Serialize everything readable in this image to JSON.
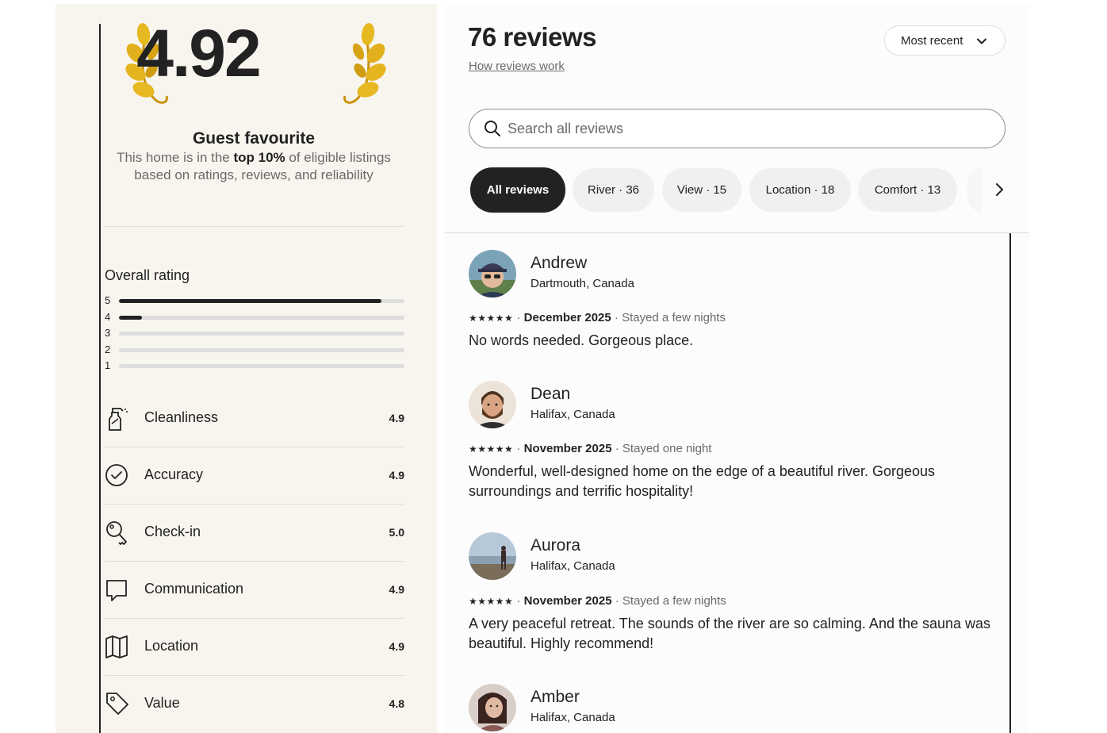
{
  "summary": {
    "score": "4.92",
    "badge_title": "Guest favourite",
    "desc_prefix": "This home is in the ",
    "desc_bold": "top 10%",
    "desc_suffix": " of eligible listings based on ratings, reviews, and reliability"
  },
  "overall": {
    "title": "Overall rating",
    "distribution": [
      {
        "label": "5",
        "fraction": 0.92
      },
      {
        "label": "4",
        "fraction": 0.08
      },
      {
        "label": "3",
        "fraction": 0
      },
      {
        "label": "2",
        "fraction": 0
      },
      {
        "label": "1",
        "fraction": 0
      }
    ]
  },
  "categories": [
    {
      "label": "Cleanliness",
      "score": "4.9",
      "icon": "spray-bottle-icon"
    },
    {
      "label": "Accuracy",
      "score": "4.9",
      "icon": "check-circle-icon"
    },
    {
      "label": "Check-in",
      "score": "5.0",
      "icon": "key-icon"
    },
    {
      "label": "Communication",
      "score": "4.9",
      "icon": "chat-bubble-icon"
    },
    {
      "label": "Location",
      "score": "4.9",
      "icon": "map-icon"
    },
    {
      "label": "Value",
      "score": "4.8",
      "icon": "price-tag-icon"
    }
  ],
  "reviews_header": {
    "title": "76 reviews",
    "how_link": "How reviews work",
    "sort_label": "Most recent"
  },
  "search": {
    "placeholder": "Search all reviews"
  },
  "filters": [
    {
      "label": "All reviews",
      "active": true
    },
    {
      "label": "River · 36",
      "active": false
    },
    {
      "label": "View · 15",
      "active": false
    },
    {
      "label": "Location · 18",
      "active": false
    },
    {
      "label": "Comfort · 13",
      "active": false
    }
  ],
  "reviews": [
    {
      "name": "Andrew",
      "location": "Dartmouth, Canada",
      "stars": "★★★★★",
      "date": "December 2025",
      "stay": "Stayed a few nights",
      "text": "No words needed. Gorgeous place."
    },
    {
      "name": "Dean",
      "location": "Halifax, Canada",
      "stars": "★★★★★",
      "date": "November 2025",
      "stay": "Stayed one night",
      "text": "Wonderful, well-designed home on the edge of a beautiful river. Gorgeous surroundings and terrific hospitality!"
    },
    {
      "name": "Aurora",
      "location": "Halifax, Canada",
      "stars": "★★★★★",
      "date": "November 2025",
      "stay": "Stayed a few nights",
      "text": "A very peaceful retreat. The sounds of the river are so calming. And the sauna was beautiful. Highly recommend!"
    },
    {
      "name": "Amber",
      "location": "Halifax, Canada"
    }
  ],
  "colors": {
    "left_bg": "#f8f5ef",
    "text": "#222222",
    "muted": "#6a6a6a",
    "chip_bg": "#f0f0f0",
    "laurel_gold": "#e0b21c"
  }
}
